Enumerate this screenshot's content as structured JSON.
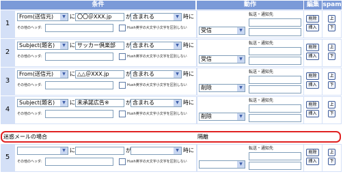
{
  "headers": {
    "condition": "条件",
    "action": "動作",
    "edit": "編集",
    "spam": "spam"
  },
  "labels": {
    "ga": "が",
    "ni": "に",
    "ji": "時に",
    "other_header": "その他のヘッダ:",
    "case_option": "Hush英字の大文字小文字を区別しない",
    "forward_notify": "転送・通知先",
    "delete_btn": "削除",
    "insert_btn": "挿入",
    "up_btn": "上",
    "down_btn": "下"
  },
  "rules": [
    {
      "num": "1",
      "field": "From(送信元)",
      "value": "〇〇＠XXX.jp",
      "match": "含まれる",
      "action": "受信",
      "forward": ""
    },
    {
      "num": "2",
      "field": "Subject(題名)",
      "value": "サッカー倶楽部",
      "match": "含まれる",
      "action": "受信",
      "forward": ""
    },
    {
      "num": "3",
      "field": "From(送信元)",
      "value": "△△＠XXX.jp",
      "match": "含まれる",
      "action": "削除",
      "forward": ""
    },
    {
      "num": "4",
      "field": "Subject(題名)",
      "value": "未承諾広告※",
      "match": "含まれる",
      "action": "削除",
      "forward": ""
    }
  ],
  "special_row": {
    "label": "迷惑メールの場合",
    "action": "隔離"
  },
  "row5": {
    "num": "5",
    "field": "",
    "value": "",
    "match": "",
    "action": "",
    "forward": ""
  },
  "icons": {
    "dropdown": "chevron-down-icon"
  }
}
